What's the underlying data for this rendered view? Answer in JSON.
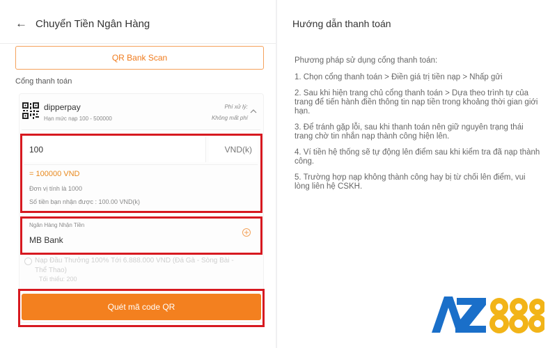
{
  "header": {
    "title": "Chuyển Tiền Ngân Hàng"
  },
  "qr_scan": {
    "label": "QR Bank Scan"
  },
  "gateway": {
    "section_label": "Cổng thanh toán",
    "name": "dipperpay",
    "limit": "Hạn mức nạp 100 - 500000",
    "fee_label": "Phí xử lý:",
    "fee_value": "Không mất phí"
  },
  "amount": {
    "value": "100",
    "currency": "VND(k)",
    "converted": "= 100000 VND",
    "unit_note": "Đơn vị tính là 1000",
    "receive_note": "Số tiền bạn nhận được : 100.00 VND(k)"
  },
  "bank": {
    "label": "Ngân Hàng Nhận Tiền",
    "value": "MB Bank"
  },
  "promo": {
    "line1": "Nạp Đầu Thưởng 100% Tới 6.888.000 VND (Đá Gà - Sòng Bài -",
    "line2": "Thể Thao)",
    "min": "Tối thiểu: 200"
  },
  "submit": {
    "label": "Quét mã code QR"
  },
  "guide": {
    "title": "Hướng dẫn thanh toán",
    "intro": "Phương pháp sử dụng cổng thanh toán:",
    "steps": [
      "1. Chọn cổng thanh toán > Điền giá trị tiền nạp > Nhấp gửi",
      "2. Sau khi hiện trang chủ cổng thanh toán > Dựa theo trình tự của trang để tiến hành điền thông tin nạp tiền trong khoảng thời gian giới hạn.",
      "3. Để tránh gặp lỗi, sau khi thanh toán nên giữ nguyên trạng thái trang chờ tin nhắn nạp thành công hiện lên.",
      "4. Ví tiền hệ thống sẽ tự động lên điểm sau khi kiểm tra đã nạp thành công.",
      "5. Trường hợp nạp không thành công hay bị từ chối lên điểm, vui lòng liên hệ CSKH."
    ]
  },
  "logo": {
    "text": "AZ888"
  },
  "colors": {
    "accent": "#f3801f",
    "highlight_border": "#d71920",
    "logo_blue": "#1a6fc9",
    "logo_gold": "#f2b418"
  }
}
